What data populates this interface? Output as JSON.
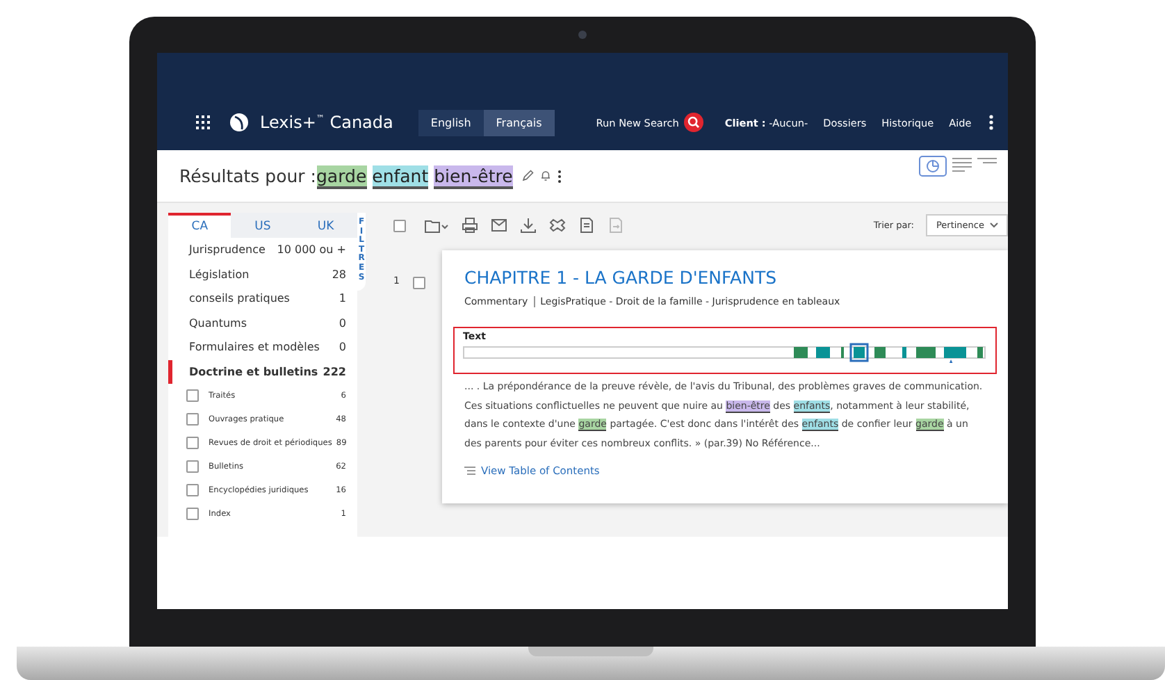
{
  "nav": {
    "brand": "Lexis+",
    "brand_mark": "™",
    "brand_region": "Canada",
    "languages": [
      {
        "label": "English",
        "selected": false
      },
      {
        "label": "Français",
        "selected": true
      }
    ],
    "run_search": "Run New Search",
    "client_label": "Client :",
    "client_value": "-Aucun-",
    "links": [
      "Dossiers",
      "Historique",
      "Aide"
    ]
  },
  "results": {
    "prefix": "Résultats pour :",
    "terms": [
      {
        "text": "garde",
        "color": "#a8d5a2"
      },
      {
        "text": "enfant",
        "color": "#9fdfe6"
      },
      {
        "text": "bien-être",
        "color": "#c9b8ec"
      }
    ]
  },
  "jurisdictions": [
    {
      "label": "CA",
      "selected": true
    },
    {
      "label": "US",
      "selected": false
    },
    {
      "label": "UK",
      "selected": false
    }
  ],
  "filters_label": "FILTRES",
  "categories": [
    {
      "kind": "category",
      "label": "Jurisprudence",
      "count": "10 000 ou +",
      "selected": false
    },
    {
      "kind": "category",
      "label": "Législation",
      "count": "28",
      "selected": false
    },
    {
      "kind": "category",
      "label": "conseils pratiques",
      "count": "1",
      "selected": false
    },
    {
      "kind": "category",
      "label": "Quantums",
      "count": "0",
      "selected": false
    },
    {
      "kind": "category",
      "label": "Formulaires et modèles",
      "count": "0",
      "selected": false
    },
    {
      "kind": "category",
      "label": "Doctrine et bulletins",
      "count": "222",
      "selected": true
    },
    {
      "kind": "subcategory",
      "label": "Traités",
      "count": "6",
      "checked": false
    },
    {
      "kind": "subcategory",
      "label": "Ouvrages pratique",
      "count": "48",
      "checked": false
    },
    {
      "kind": "subcategory",
      "label": "Revues de droit et périodiques",
      "count": "89",
      "checked": false
    },
    {
      "kind": "subcategory",
      "label": "Bulletins",
      "count": "62",
      "checked": false
    },
    {
      "kind": "subcategory",
      "label": "Encyclopédies juridiques",
      "count": "16",
      "checked": false
    },
    {
      "kind": "subcategory",
      "label": "Index",
      "count": "1",
      "checked": false
    }
  ],
  "toolbar": {
    "select_all_checked": false,
    "sort_label": "Trier par:",
    "sort_value": "Pertinence"
  },
  "result": {
    "number": "1",
    "checked": false,
    "title": "CHAPITRE 1 - LA GARDE D'ENFANTS",
    "type": "Commentary",
    "source": "LegisPratique - Droit de la famille - Jurisprudence en tableaux",
    "hit_label": "Text",
    "snippet": [
      {
        "kind": "plain",
        "text": "... . La prépondérance de la preuve révèle, de l'avis du Tribunal, des problèmes graves de communication. Ces situations conflictuelles ne peuvent que nuire au "
      },
      {
        "kind": "term",
        "text": "bien-être",
        "color": "#c9b8ec"
      },
      {
        "kind": "plain",
        "text": " des "
      },
      {
        "kind": "term",
        "text": "enfants",
        "color": "#9fdfe6"
      },
      {
        "kind": "plain",
        "text": ", notamment à leur stabilité, dans le contexte d'une "
      },
      {
        "kind": "term",
        "text": "garde",
        "color": "#a8d5a2"
      },
      {
        "kind": "plain",
        "text": " partagée. C'est donc dans l'intérêt des "
      },
      {
        "kind": "term",
        "text": "enfants",
        "color": "#9fdfe6"
      },
      {
        "kind": "plain",
        "text": " de confier leur "
      },
      {
        "kind": "term",
        "text": "garde",
        "color": "#a8d5a2"
      },
      {
        "kind": "plain",
        "text": " à un des parents pour éviter ces nombreux conflits. » (par.39) No Référence..."
      }
    ],
    "toc_link": "View Table of Contents"
  }
}
